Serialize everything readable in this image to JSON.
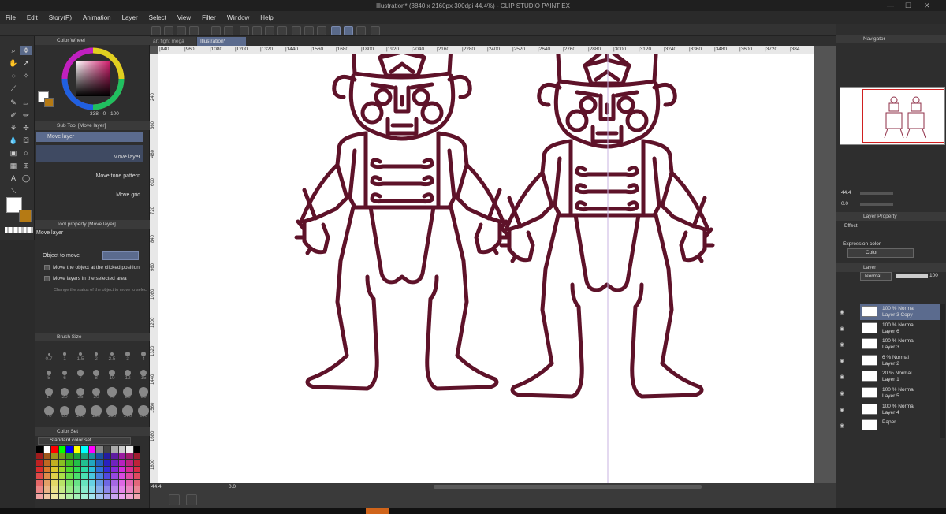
{
  "app": {
    "title": "Illustration* (3840 x 2160px 300dpi 44.4%) - CLIP STUDIO PAINT EX"
  },
  "menu": [
    "File",
    "Edit",
    "Story(P)",
    "Animation",
    "Layer",
    "Select",
    "View",
    "Filter",
    "Window",
    "Help"
  ],
  "doc_tabs": [
    {
      "label": "art fight mega"
    },
    {
      "label": "Illustration*"
    }
  ],
  "ruler_top": [
    "840",
    "960",
    "1080",
    "1200",
    "1320",
    "1440",
    "1560",
    "1680",
    "1800",
    "1920",
    "2040",
    "2160",
    "2280",
    "2400",
    "2520",
    "2640",
    "2760",
    "2880",
    "3000",
    "3120",
    "3240",
    "3360",
    "3480",
    "3600",
    "3720",
    "384"
  ],
  "ruler_left": [
    "240",
    "360",
    "480",
    "600",
    "720",
    "840",
    "960",
    "1080",
    "1200",
    "1320",
    "1440",
    "1560",
    "1680",
    "1800",
    "1920"
  ],
  "left_panel": {
    "color_wheel": {
      "title": "Color Wheel",
      "readout": "338",
      "readout2": "0",
      "readout3": "100"
    },
    "sub_tool": {
      "title": "Sub Tool [Move layer]",
      "group": "Move layer",
      "items": [
        "Move layer",
        "Move tone pattern",
        "Move grid"
      ]
    },
    "tool_property": {
      "title": "Tool property [Move layer]",
      "name": "Move layer",
      "object_to_move_label": "Object to move",
      "options": [
        "Move the object at the clicked position",
        "Move layers in the selected area",
        "Change the status of the object to move to selec"
      ]
    },
    "brush_size": {
      "title": "Brush Size",
      "sizes": [
        "0.7",
        "1",
        "1.5",
        "2",
        "2.5",
        "3",
        "4",
        "5",
        "6",
        "7",
        "8",
        "10",
        "12",
        "15",
        "17",
        "20",
        "25",
        "30",
        "40",
        "50",
        "60",
        "70",
        "80",
        "100",
        "120",
        "150",
        "170",
        "200"
      ]
    },
    "color_set": {
      "title": "Color Set",
      "selected": "Standard color set"
    }
  },
  "status": {
    "zoom": "44.4",
    "angle": "0.0"
  },
  "right_panel": {
    "navigator": {
      "title": "Navigator"
    },
    "nav_zoom": "44.4",
    "nav_angle": "0.0",
    "layer_property": {
      "title": "Layer Property",
      "effect_label": "Effect",
      "expression_label": "Expression color",
      "expression_value": "Color"
    },
    "layer_panel": {
      "title": "Layer",
      "blend": "Normal",
      "opacity": "100"
    },
    "layers": [
      {
        "line1": "100 % Normal",
        "line2": "Layer 3 Copy",
        "selected": true
      },
      {
        "line1": "100 % Normal",
        "line2": "Layer 6",
        "selected": false
      },
      {
        "line1": "100 % Normal",
        "line2": "Layer 3",
        "selected": false
      },
      {
        "line1": "6 % Normal",
        "line2": "Layer 2",
        "selected": false
      },
      {
        "line1": "20 % Normal",
        "line2": "Layer 1",
        "selected": false
      },
      {
        "line1": "100 % Normal",
        "line2": "Layer 5",
        "selected": false
      },
      {
        "line1": "100 % Normal",
        "line2": "Layer 4",
        "selected": false
      },
      {
        "line1": "",
        "line2": "Paper",
        "selected": false
      }
    ]
  },
  "colors": {
    "stroke": "#5e1229",
    "accent": "#5b6b8e",
    "main_color": "#ffffff",
    "sub_color": "#b57a14"
  }
}
